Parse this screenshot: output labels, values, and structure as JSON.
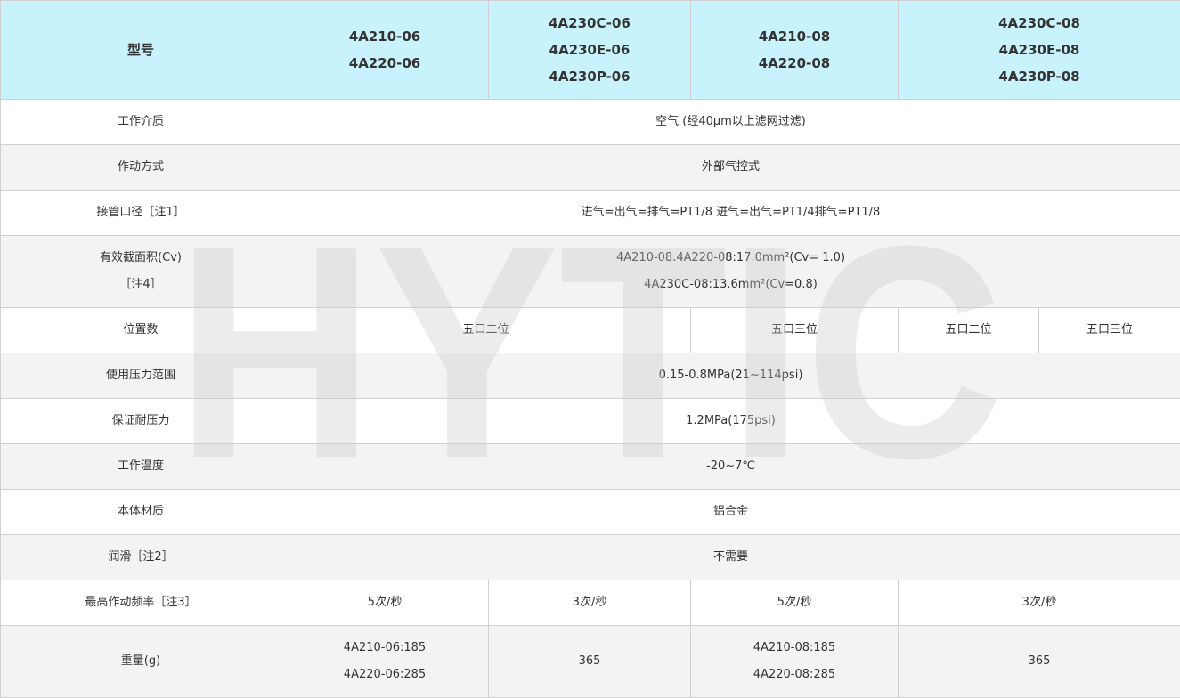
{
  "header": {
    "label": "型号",
    "models": [
      [
        "4A210-06",
        "4A220-06"
      ],
      [
        "4A230C-06",
        "4A230E-06",
        "4A230P-06"
      ],
      [
        "4A210-08",
        "4A220-08"
      ],
      [
        "4A230C-08",
        "4A230E-08",
        "4A230P-08"
      ]
    ]
  },
  "rows": {
    "medium": {
      "label": "工作介质",
      "value": "空气 (经40μm以上滤网过滤)"
    },
    "actuation": {
      "label": "作动方式",
      "value": "外部气控式"
    },
    "port": {
      "label": "接管口径［注1］",
      "value": "进气=出气=排气=PT1/8 进气=出气=PT1/4排气=PT1/8"
    },
    "area": {
      "label_lines": [
        "有效截面积(Cv)",
        "［注4］"
      ],
      "value_lines": [
        "4A210-08.4A220-08:17.0mm²(Cv= 1.0)",
        "4A230C-08:13.6mm²(Cv=0.8)"
      ]
    },
    "positions": {
      "label": "位置数",
      "values": [
        "五口二位",
        "五口三位",
        "五口二位",
        "五口三位"
      ]
    },
    "pressure": {
      "label": "使用压力范围",
      "value": "0.15-0.8MPa(21~114psi)"
    },
    "proof": {
      "label": "保证耐压力",
      "value": "1.2MPa(175psi)"
    },
    "temp": {
      "label": "工作温度",
      "value": "-20~7℃"
    },
    "material": {
      "label": "本体材质",
      "value": "铝合金"
    },
    "lube": {
      "label": "润滑［注2］",
      "value": "不需要"
    },
    "freq": {
      "label": "最高作动频率［注3］",
      "values": [
        "5次/秒",
        "3次/秒",
        "5次/秒",
        "3次/秒"
      ]
    },
    "weight": {
      "label": "重量(g)",
      "col1": [
        "4A210-06:185",
        "4A220-06:285"
      ],
      "col2": "365",
      "col3": [
        "4A210-08:185",
        "4A220-08:285"
      ],
      "col4": "365"
    }
  },
  "watermark": "HYTIC"
}
